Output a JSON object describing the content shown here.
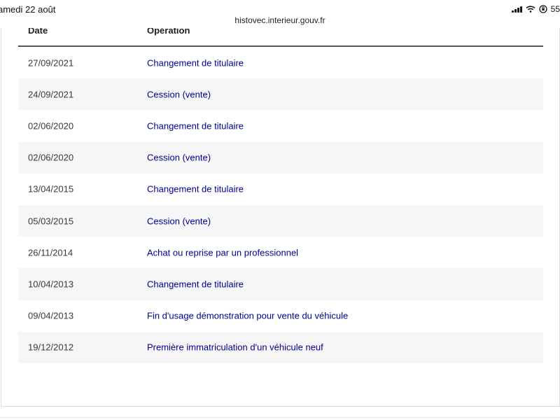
{
  "status_bar": {
    "time": "amedi 22 août",
    "battery": "55"
  },
  "browser": {
    "url": "histovec.interieur.gouv.fr"
  },
  "table": {
    "headers": {
      "date": "Date",
      "operation": "Opération"
    },
    "rows": [
      {
        "date": "27/09/2021",
        "operation": "Changement de titulaire"
      },
      {
        "date": "24/09/2021",
        "operation": "Cession (vente)"
      },
      {
        "date": "02/06/2020",
        "operation": "Changement de titulaire"
      },
      {
        "date": "02/06/2020",
        "operation": "Cession (vente)"
      },
      {
        "date": "13/04/2015",
        "operation": "Changement de titulaire"
      },
      {
        "date": "05/03/2015",
        "operation": "Cession (vente)"
      },
      {
        "date": "26/11/2014",
        "operation": "Achat ou reprise par un professionnel"
      },
      {
        "date": "10/04/2013",
        "operation": "Changement de titulaire"
      },
      {
        "date": "09/04/2013",
        "operation": "Fin d'usage démonstration pour vente du véhicule"
      },
      {
        "date": "19/12/2012",
        "operation": "Première immatriculation d'un véhicule neuf"
      }
    ]
  },
  "colors": {
    "link": "#000091",
    "stripe": "#f6f6f6",
    "header_border": "#555555"
  }
}
